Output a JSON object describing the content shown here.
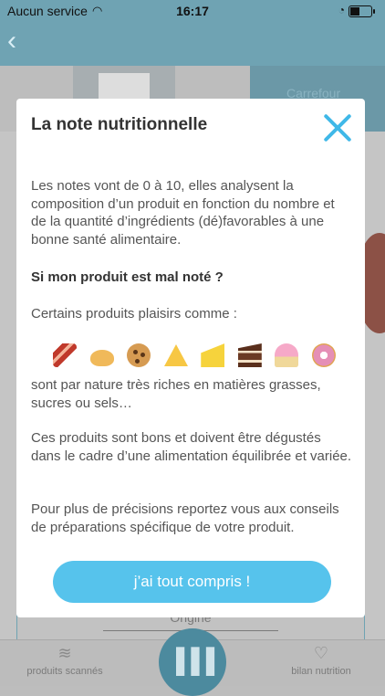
{
  "status_bar": {
    "carrier": "Aucun service",
    "time": "16:17"
  },
  "background": {
    "brand": "Carrefour",
    "origin_label": "Origine",
    "tabs": {
      "left": "produits scannés",
      "right": "bilan nutrition"
    }
  },
  "modal": {
    "title": "La note nutritionnelle",
    "intro": "Les notes vont de 0 à 10, elles analysent la composition d’un produit en fonction du nombre et de la quantité d’ingrédients (dé)favorables à une bonne santé alimentaire.",
    "question": "Si mon produit est mal noté ?",
    "certains": "Certains produits plaisirs comme :",
    "emojis": [
      "bacon-icon",
      "croissant-icon",
      "cookie-icon",
      "pizza-icon",
      "cheese-icon",
      "cake-icon",
      "cupcake-icon",
      "donut-icon"
    ],
    "nature": "sont par nature très riches en matières grasses, sucres ou sels…",
    "bons": "Ces produits sont bons et doivent être dégustés dans le cadre d’une alimentation équilibrée et variée.",
    "precisions": "Pour plus de précisions reportez vous aux conseils de préparations spécifique de votre produit.",
    "cta": "j’ai tout compris !"
  },
  "colors": {
    "accent": "#56c3ec",
    "header": "#6fa3b3"
  }
}
